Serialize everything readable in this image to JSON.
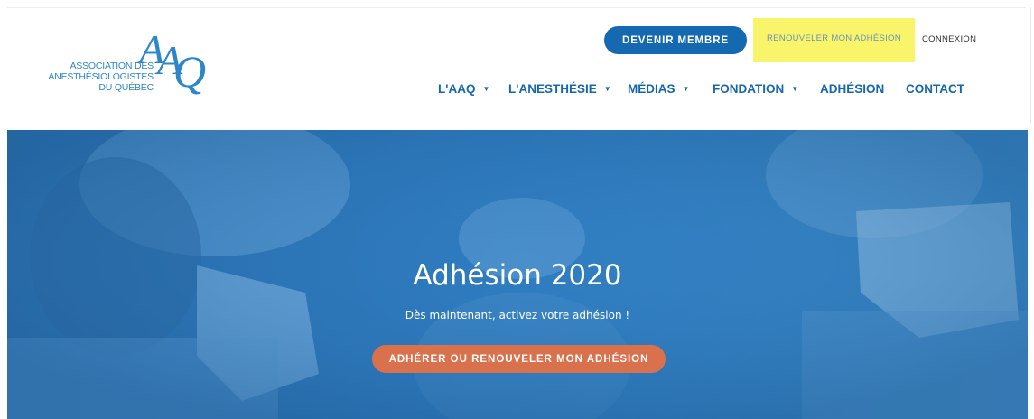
{
  "colors": {
    "brand_blue": "#1469b0",
    "nav_blue": "#1667ad",
    "logo_blue": "#2d86c8",
    "highlight_yellow": "#f8f56a",
    "cta_orange": "#d9714d",
    "hero_overlay": "#2f7cc0"
  },
  "logo": {
    "letters": "AAQ",
    "line1": "ASSOCIATION DES",
    "line2": "ANESTHÉSIOLOGISTES",
    "line3": "DU QUÉBEC"
  },
  "header": {
    "become_member": "DEVENIR MEMBRE",
    "renew_link": "RENOUVELER MON ADHÉSION",
    "login": "CONNEXION"
  },
  "nav": {
    "items": [
      {
        "label": "L'AAQ",
        "icon": "caret-down-icon",
        "has_dropdown": true
      },
      {
        "label": "L'ANESTHÉSIE",
        "icon": "caret-down-icon",
        "has_dropdown": true
      },
      {
        "label": "MÉDIAS",
        "icon": "caret-down-icon",
        "has_dropdown": true
      },
      {
        "label": "FONDATION",
        "icon": "caret-down-icon",
        "has_dropdown": true
      },
      {
        "label": "ADHÉSION",
        "has_dropdown": false
      },
      {
        "label": "CONTACT",
        "has_dropdown": false
      }
    ],
    "caret": "▼"
  },
  "hero": {
    "title": "Adhésion 2020",
    "subtitle": "Dès maintenant, activez votre adhésion !",
    "cta": "ADHÉRER OU RENOUVELER MON ADHÉSION"
  }
}
